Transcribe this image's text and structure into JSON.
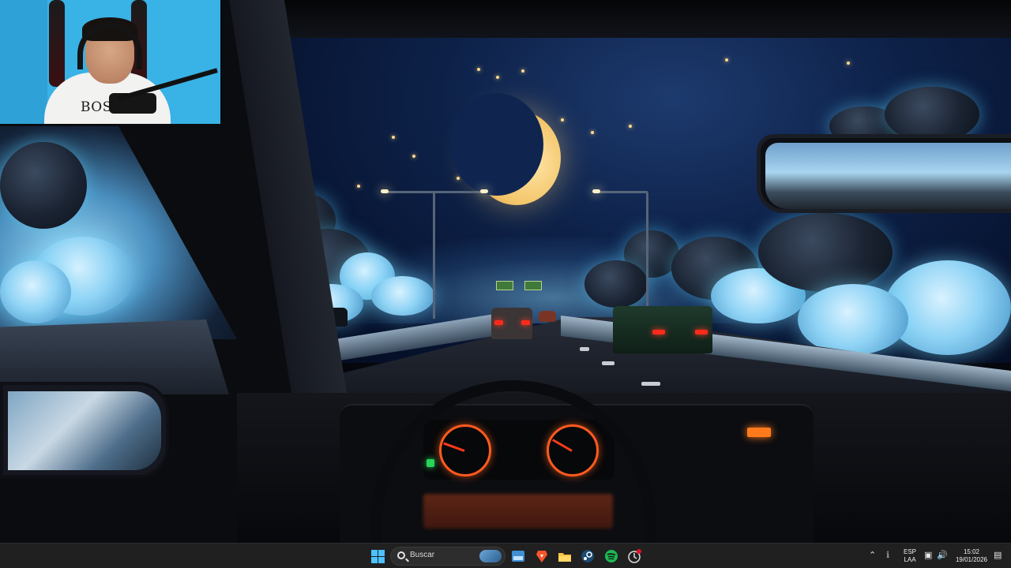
{
  "webcam": {
    "shirt_text": "BOST"
  },
  "taskbar": {
    "search": {
      "placeholder": "Buscar"
    },
    "pinned_apps": [
      {
        "name": "widgets-icon",
        "color": "#4aa3df"
      },
      {
        "name": "brave-browser-icon",
        "color": "#fb542b"
      },
      {
        "name": "file-explorer-icon",
        "color": "#f4c443"
      },
      {
        "name": "steam-icon",
        "color": "#1b2838"
      },
      {
        "name": "spotify-icon",
        "color": "#1db954"
      },
      {
        "name": "app-with-badge-icon",
        "color": "#dddddd"
      }
    ],
    "tray": {
      "language_top": "ESP",
      "language_bottom": "LAA",
      "time": "15:02",
      "date": "19/01/2026"
    }
  },
  "colors": {
    "taskbar_bg": "#202020",
    "start_blue": "#4cc2ff",
    "notification_badge": "#e81123"
  }
}
